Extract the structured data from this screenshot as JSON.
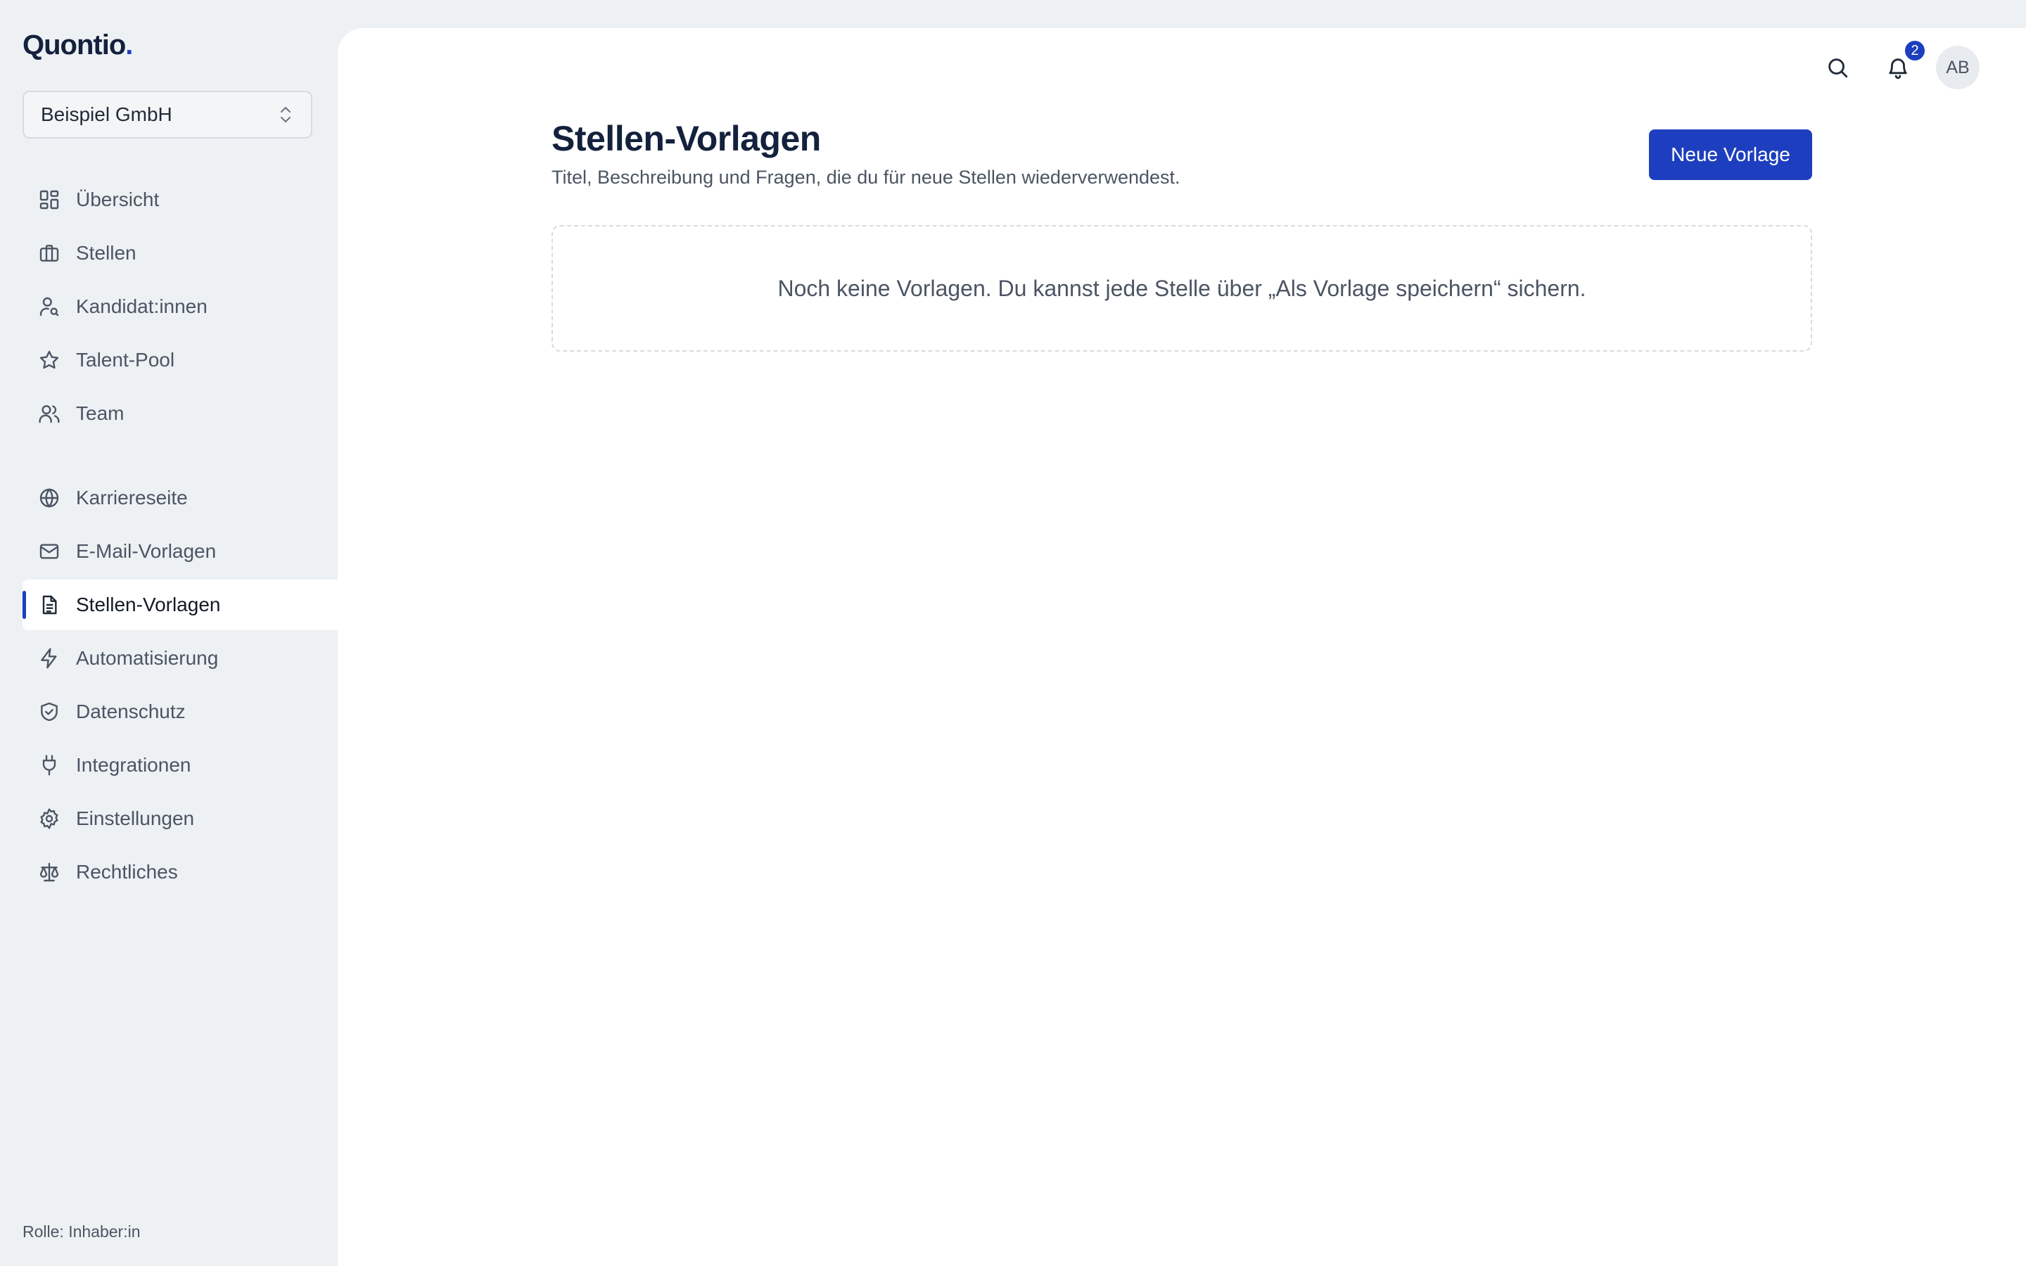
{
  "app": {
    "logo_text": "Quontio",
    "logo_dot": ".",
    "org_selector": "Beispiel GmbH",
    "role_text": "Rolle: Inhaber:in",
    "accent_color": "#1d3fbf"
  },
  "sidebar": {
    "items": [
      {
        "label": "Übersicht",
        "icon": "dashboard-icon"
      },
      {
        "label": "Stellen",
        "icon": "briefcase-icon"
      },
      {
        "label": "Kandidat:innen",
        "icon": "user-search-icon"
      },
      {
        "label": "Talent-Pool",
        "icon": "star-icon"
      },
      {
        "label": "Team",
        "icon": "users-icon"
      },
      {
        "label": "Karriereseite",
        "icon": "globe-icon"
      },
      {
        "label": "E-Mail-Vorlagen",
        "icon": "mail-icon"
      },
      {
        "label": "Stellen-Vorlagen",
        "icon": "document-icon",
        "active": true
      },
      {
        "label": "Automatisierung",
        "icon": "lightning-icon"
      },
      {
        "label": "Datenschutz",
        "icon": "shield-check-icon"
      },
      {
        "label": "Integrationen",
        "icon": "plug-icon"
      },
      {
        "label": "Einstellungen",
        "icon": "gear-icon"
      },
      {
        "label": "Rechtliches",
        "icon": "scale-icon"
      }
    ]
  },
  "header": {
    "notification_count": "2",
    "avatar_initials": "AB"
  },
  "main": {
    "title": "Stellen-Vorlagen",
    "subtitle": "Titel, Beschreibung und Fragen, die du für neue Stellen wiederverwendest.",
    "new_button": "Neue Vorlage",
    "empty_message": "Noch keine Vorlagen. Du kannst jede Stelle über „Als Vorlage speichern“ sichern."
  }
}
